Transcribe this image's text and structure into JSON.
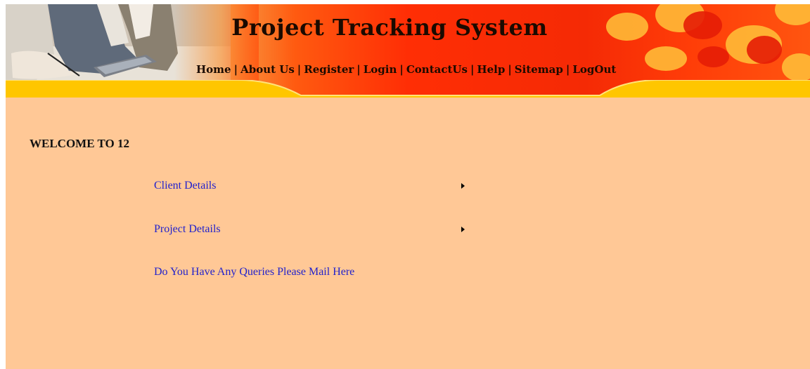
{
  "header": {
    "title": "Project Tracking System",
    "nav": [
      {
        "label": "Home",
        "icon": ""
      },
      {
        "label": "About Us"
      },
      {
        "label": "Register"
      },
      {
        "label": "Login"
      },
      {
        "label": "ContactUs"
      },
      {
        "label": "Help"
      },
      {
        "label": "Sitemap"
      },
      {
        "label": "LogOut"
      }
    ],
    "separator": "|"
  },
  "main": {
    "welcome": "WELCOME TO 12",
    "menu": [
      {
        "label": "Client Details",
        "icon": "arrow-right-icon"
      },
      {
        "label": "Project Details",
        "icon": "arrow-right-icon"
      }
    ],
    "mail_link": "Do You Have Any Queries Please Mail Here"
  },
  "colors": {
    "page_background": "#ffc896",
    "banner_red": "#ff2e05",
    "banner_band": "#ffc600",
    "link": "#2222cc"
  }
}
